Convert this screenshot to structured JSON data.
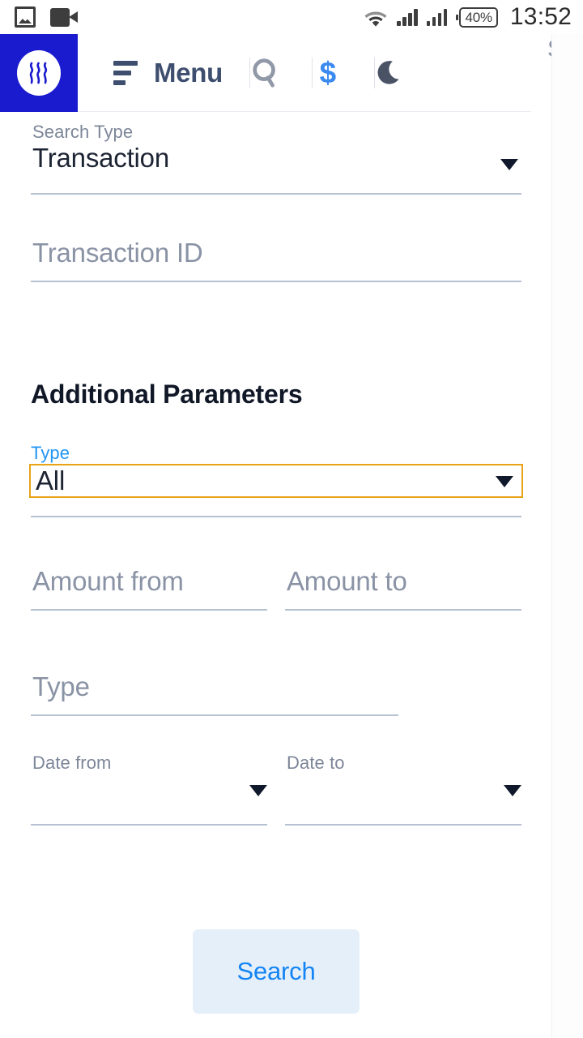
{
  "status_bar": {
    "icons": [
      "screenshot-icon",
      "video-record-icon",
      "wifi-icon",
      "signal-icon",
      "signal-icon"
    ],
    "battery": "40%",
    "time": "13:52"
  },
  "header": {
    "brand": "steem-logo",
    "menu_label": "Menu",
    "icons": [
      "menu-icon",
      "search-icon",
      "dollar-icon",
      "dark-mode-moon-icon"
    ],
    "side_text": "SBD",
    "accent_blue": "#3B8AF0",
    "brand_blue": "#1A1ACF"
  },
  "form": {
    "search_type": {
      "label": "Search Type",
      "value": "Transaction"
    },
    "transaction_id": {
      "placeholder": "Transaction ID",
      "value": ""
    },
    "section_title": "Additional Parameters",
    "type_select": {
      "label": "Type",
      "value": "All",
      "focus_color": "#E8A317",
      "label_color": "#2196F3"
    },
    "amount_from": {
      "placeholder": "Amount from",
      "value": ""
    },
    "amount_to": {
      "placeholder": "Amount to",
      "value": ""
    },
    "type_text": {
      "placeholder": "Type",
      "value": ""
    },
    "date_from": {
      "label": "Date from",
      "value": ""
    },
    "date_to": {
      "label": "Date to",
      "value": ""
    },
    "search_button": {
      "label": "Search",
      "background": "#E5EFF9",
      "text_color": "#1384F5"
    }
  }
}
